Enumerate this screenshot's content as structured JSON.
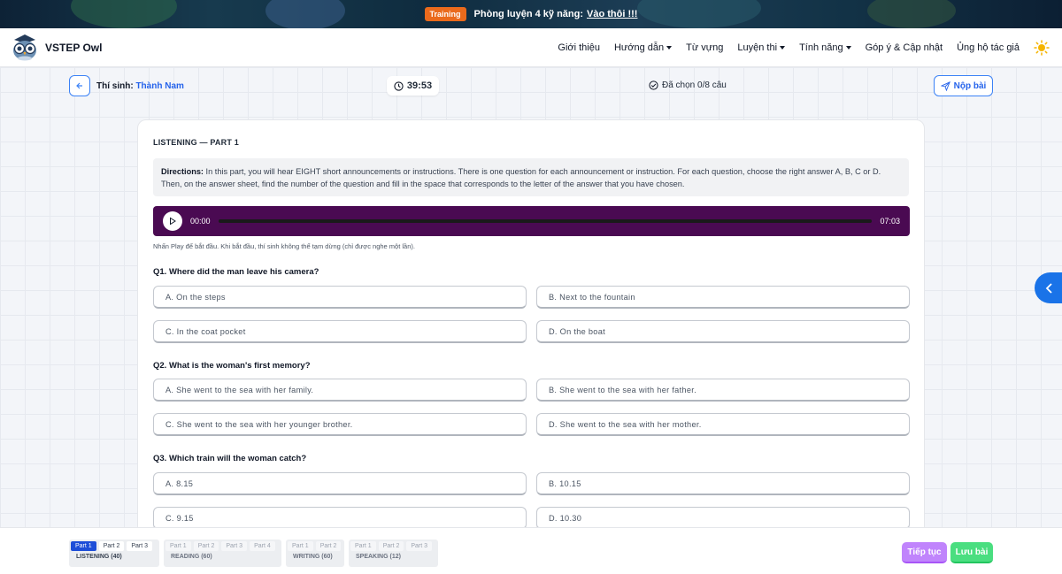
{
  "banner": {
    "tag": "Training",
    "text": "Phòng luyện 4 kỹ năng:",
    "link": "Vào thôi !!!"
  },
  "brand": {
    "name": "VSTEP Owl"
  },
  "nav": {
    "items": [
      "Giới thiệu",
      "Hướng dẫn",
      "Từ vựng",
      "Luyện thi",
      "Tính năng",
      "Góp ý & Cập nhật",
      "Ủng hộ tác giả"
    ]
  },
  "exam_bar": {
    "candidate_label": "Thí sinh:",
    "candidate_name": "Thành Nam",
    "timer": "39:53",
    "selected": "Đã chọn 0/8 câu",
    "submit": "Nộp bài"
  },
  "section": {
    "title": "LISTENING — PART 1",
    "directions_label": "Directions:",
    "directions_text": " In this part, you will hear EIGHT short announcements or instructions. There is one question for each announcement or instruction. For each question, choose the right answer A, B, C or D. Then, on the answer sheet, find the number of the question and fill in the space that corresponds to the letter of the answer that you have chosen.",
    "audio": {
      "current": "00:00",
      "duration": "07:03",
      "progress": 0
    },
    "hint": "Nhấn Play để bắt đầu. Khi bắt đầu, thí sinh không thể tạm dừng (chỉ được nghe một lần)."
  },
  "questions": [
    {
      "q": "Q1. Where did the man leave his camera?",
      "opts": [
        "A.  On the steps",
        "B.  Next to the fountain",
        "C.  In the coat pocket",
        "D.  On the boat"
      ]
    },
    {
      "q": "Q2. What is the woman's first memory?",
      "opts": [
        "A.  She went to the sea with her family.",
        "B.  She went to the sea with her father.",
        "C.  She went to the sea with her younger brother.",
        "D.  She went to the sea with her mother."
      ]
    },
    {
      "q": "Q3. Which train will the woman catch?",
      "opts": [
        "A.  8.15",
        "B.  10.15",
        "C.  9.15",
        "D.  10.30"
      ]
    }
  ],
  "footer": {
    "skills": [
      {
        "name": "LISTENING (40)",
        "parts": [
          "Part 1",
          "Part 2",
          "Part 3"
        ]
      },
      {
        "name": "READING (60)",
        "parts": [
          "Part 1",
          "Part 2",
          "Part 3",
          "Part 4"
        ]
      },
      {
        "name": "WRITING (60)",
        "parts": [
          "Part 1",
          "Part 2"
        ]
      },
      {
        "name": "SPEAKING (12)",
        "parts": [
          "Part 1",
          "Part 2",
          "Part 3"
        ]
      }
    ],
    "next": "Tiếp tục",
    "save": "Lưu bài"
  },
  "colors": {
    "accent": "#2563eb",
    "player": "#4a0a52",
    "next": "#c084fc",
    "save": "#4ade80",
    "banner_tag": "#ea6a1c"
  }
}
